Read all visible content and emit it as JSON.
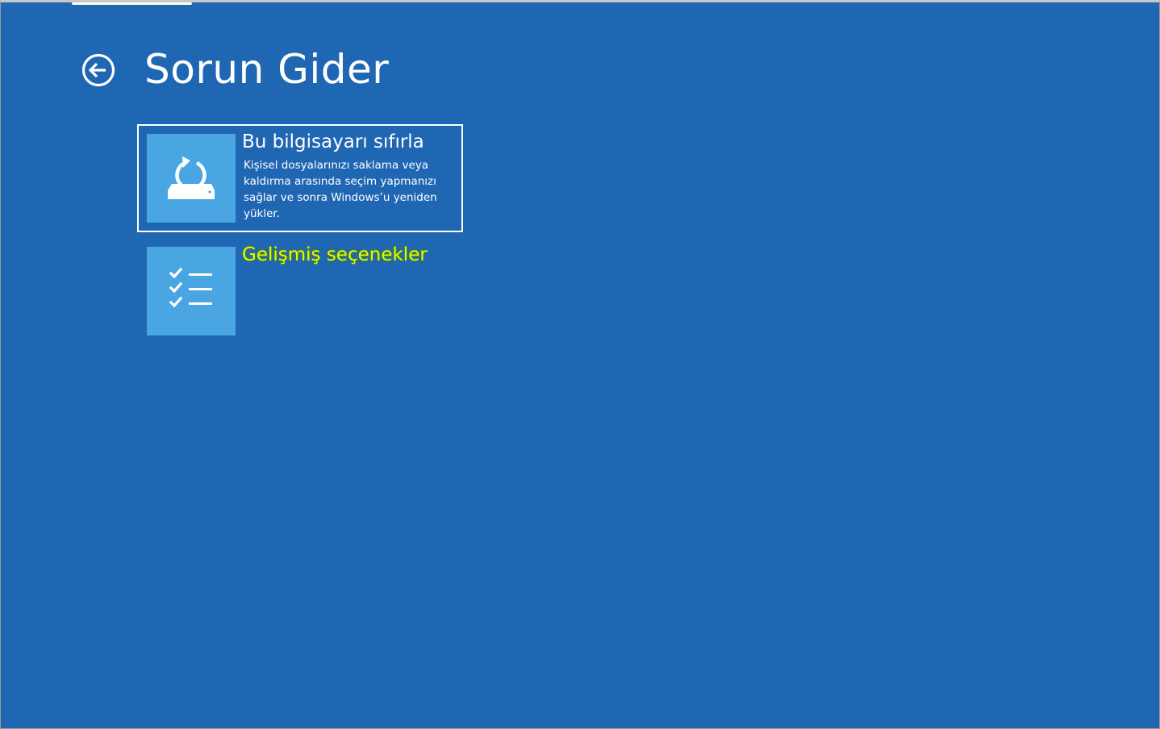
{
  "screen": {
    "title": "Sorun Gider",
    "back_icon": "arrow-left-circle-icon"
  },
  "options": [
    {
      "title": "Bu bilgisayarı sıfırla",
      "description": "Kişisel dosyalarınızı saklama veya kaldırma arasında seçim yapmanızı sağlar ve sonra Windows’u yeniden yükler.",
      "icon": "reset-pc-icon",
      "selected": true
    },
    {
      "title": "Gelişmiş seçenekler",
      "description": "",
      "icon": "checklist-icon",
      "highlighted": true
    }
  ],
  "colors": {
    "background": "#2067b3",
    "tile": "#4aa6e2",
    "text": "#ffffff",
    "highlight_text": "#f2f500"
  }
}
